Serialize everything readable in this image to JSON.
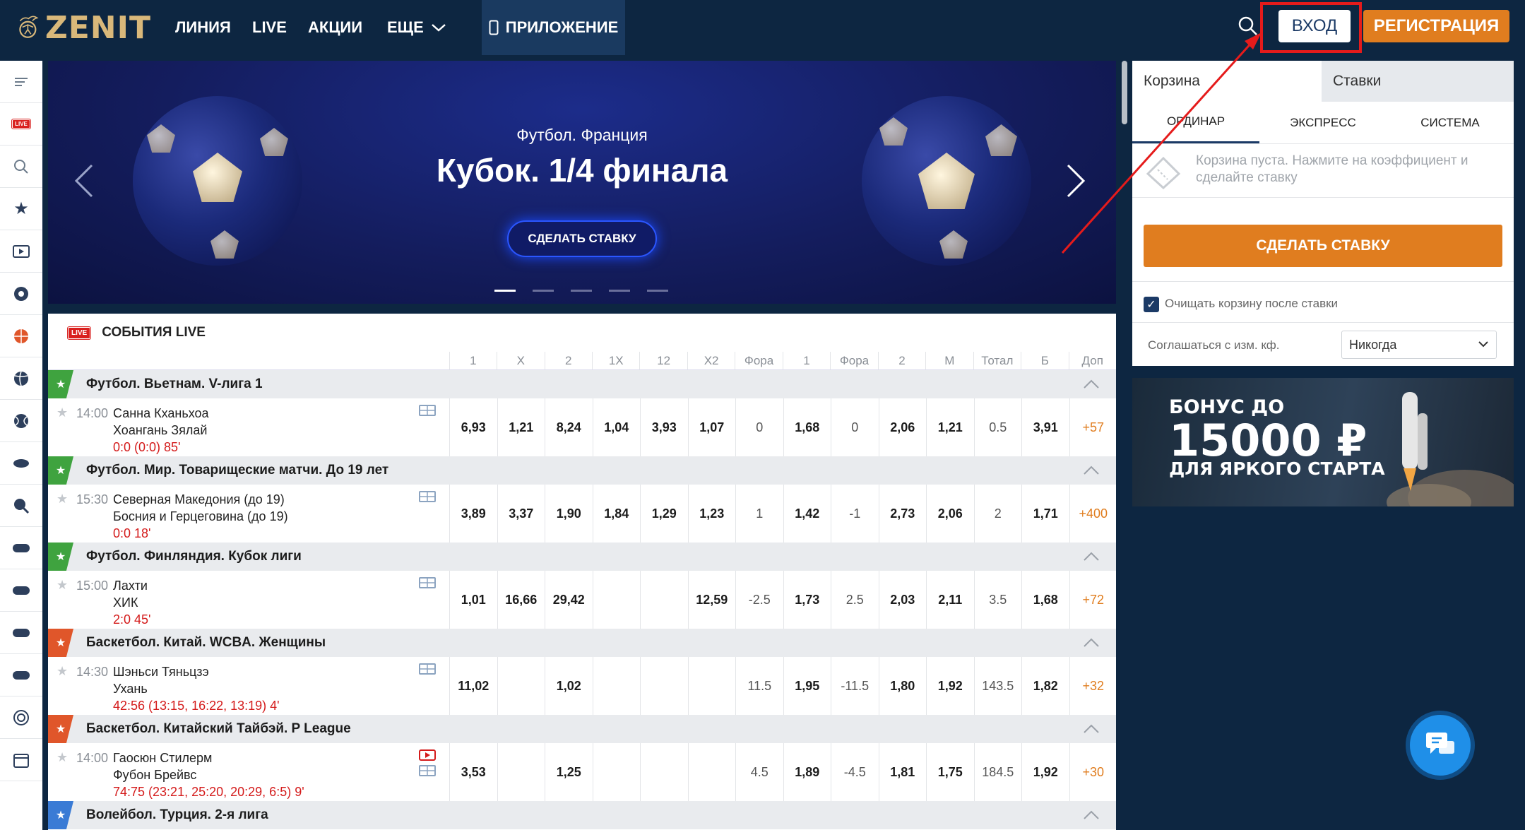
{
  "header": {
    "logo_text": "ZENIT",
    "nav": [
      "ЛИНИЯ",
      "LIVE",
      "АКЦИИ",
      "ЕЩЕ"
    ],
    "app_label": "ПРИЛОЖЕНИЕ",
    "login_label": "ВХОД",
    "register_label": "РЕГИСТРАЦИЯ"
  },
  "sidebar": {
    "icons": [
      "menu-icon",
      "live-icon",
      "search-icon",
      "star-icon",
      "video-icon",
      "football-icon",
      "basketball-icon",
      "volleyball-icon",
      "tennis-icon",
      "hockey-icon",
      "table-tennis-icon",
      "gamepad-icon",
      "gamepad-icon",
      "gamepad-icon",
      "gamepad-icon",
      "target-icon",
      "calendar-icon"
    ],
    "live_badge": "LIVE"
  },
  "banner": {
    "subtitle": "Футбол. Франция",
    "title": "Кубок. 1/4 финала",
    "button": "СДЕЛАТЬ СТАВКУ",
    "active_slide": 1,
    "slides": 5
  },
  "live": {
    "badge": "LIVE",
    "title": "СОБЫТИЯ LIVE",
    "columns": [
      "1",
      "X",
      "2",
      "1X",
      "12",
      "X2",
      "Фора",
      "1",
      "Фора",
      "2",
      "М",
      "Тотал",
      "Б",
      "Доп"
    ],
    "leagues": [
      {
        "sport_color": "#3fa33f",
        "name": "Футбол. Вьетнам. V-лига 1",
        "time": "14:00",
        "team1": "Санна Кханьхоа",
        "team2": "Хоангань Зялай",
        "score": "0:0 (0:0) 85'",
        "odds": [
          "6,93",
          "1,21",
          "8,24",
          "1,04",
          "3,93",
          "1,07",
          "0",
          "1,68",
          "0",
          "2,06",
          "1,21",
          "0.5",
          "3,91",
          "+57"
        ]
      },
      {
        "sport_color": "#3fa33f",
        "name": "Футбол. Мир. Товарищеские матчи. До 19 лет",
        "time": "15:30",
        "team1": "Северная Македония (до 19)",
        "team2": "Босния и Герцеговина (до 19)",
        "score": "0:0 18'",
        "odds": [
          "3,89",
          "3,37",
          "1,90",
          "1,84",
          "1,29",
          "1,23",
          "1",
          "1,42",
          "-1",
          "2,73",
          "2,06",
          "2",
          "1,71",
          "+400"
        ]
      },
      {
        "sport_color": "#3fa33f",
        "name": "Футбол. Финляндия. Кубок лиги",
        "time": "15:00",
        "team1": "Лахти",
        "team2": "ХИК",
        "score": "2:0 45'",
        "odds": [
          "1,01",
          "16,66",
          "29,42",
          "",
          "",
          "12,59",
          "-2.5",
          "1,73",
          "2.5",
          "2,03",
          "2,11",
          "3.5",
          "1,68",
          "+72"
        ]
      },
      {
        "sport_color": "#e0562a",
        "name": "Баскетбол. Китай. WCBA. Женщины",
        "time": "14:30",
        "team1": "Шэньси Тяньцзэ",
        "team2": "Ухань",
        "score": "42:56 (13:15, 16:22, 13:19) 4'",
        "odds": [
          "11,02",
          "",
          "1,02",
          "",
          "",
          "",
          "11.5",
          "1,95",
          "-11.5",
          "1,80",
          "1,92",
          "143.5",
          "1,82",
          "+32"
        ]
      },
      {
        "sport_color": "#e0562a",
        "name": "Баскетбол. Китайский Тайбэй. P League",
        "time": "14:00",
        "team1": "Гаосюн Стилерм",
        "team2": "Фубон Брейвс",
        "score": "74:75 (23:21, 25:20, 20:29, 6:5) 9'",
        "odds": [
          "3,53",
          "",
          "1,25",
          "",
          "",
          "",
          "4.5",
          "1,89",
          "-4.5",
          "1,81",
          "1,75",
          "184.5",
          "1,92",
          "+30"
        ]
      },
      {
        "sport_color": "#3a7bd5",
        "name": "Волейбол. Турция. 2-я лига"
      }
    ]
  },
  "betslip": {
    "tab_basket": "Корзина",
    "tab_bets": "Ставки",
    "subtabs": [
      "ОРДИНАР",
      "ЭКСПРЕСС",
      "СИСТЕМА"
    ],
    "empty_text": "Корзина пуста. Нажмите на коэффициент и сделайте ставку",
    "make_bet": "СДЕЛАТЬ СТАВКУ",
    "clear_label": "Очищать корзину после ставки",
    "agree_label": "Соглашаться с изм. кф.",
    "agree_value": "Никогда"
  },
  "bonus": {
    "line1": "БОНУС ДО",
    "line2": "15000 ₽",
    "line3": "ДЛЯ ЯРКОГО СТАРТА"
  },
  "colors": {
    "header_bg": "#0d2641",
    "accent": "#e07d1f",
    "live_red": "#d41b1b",
    "annotation_red": "#e51b1b"
  }
}
